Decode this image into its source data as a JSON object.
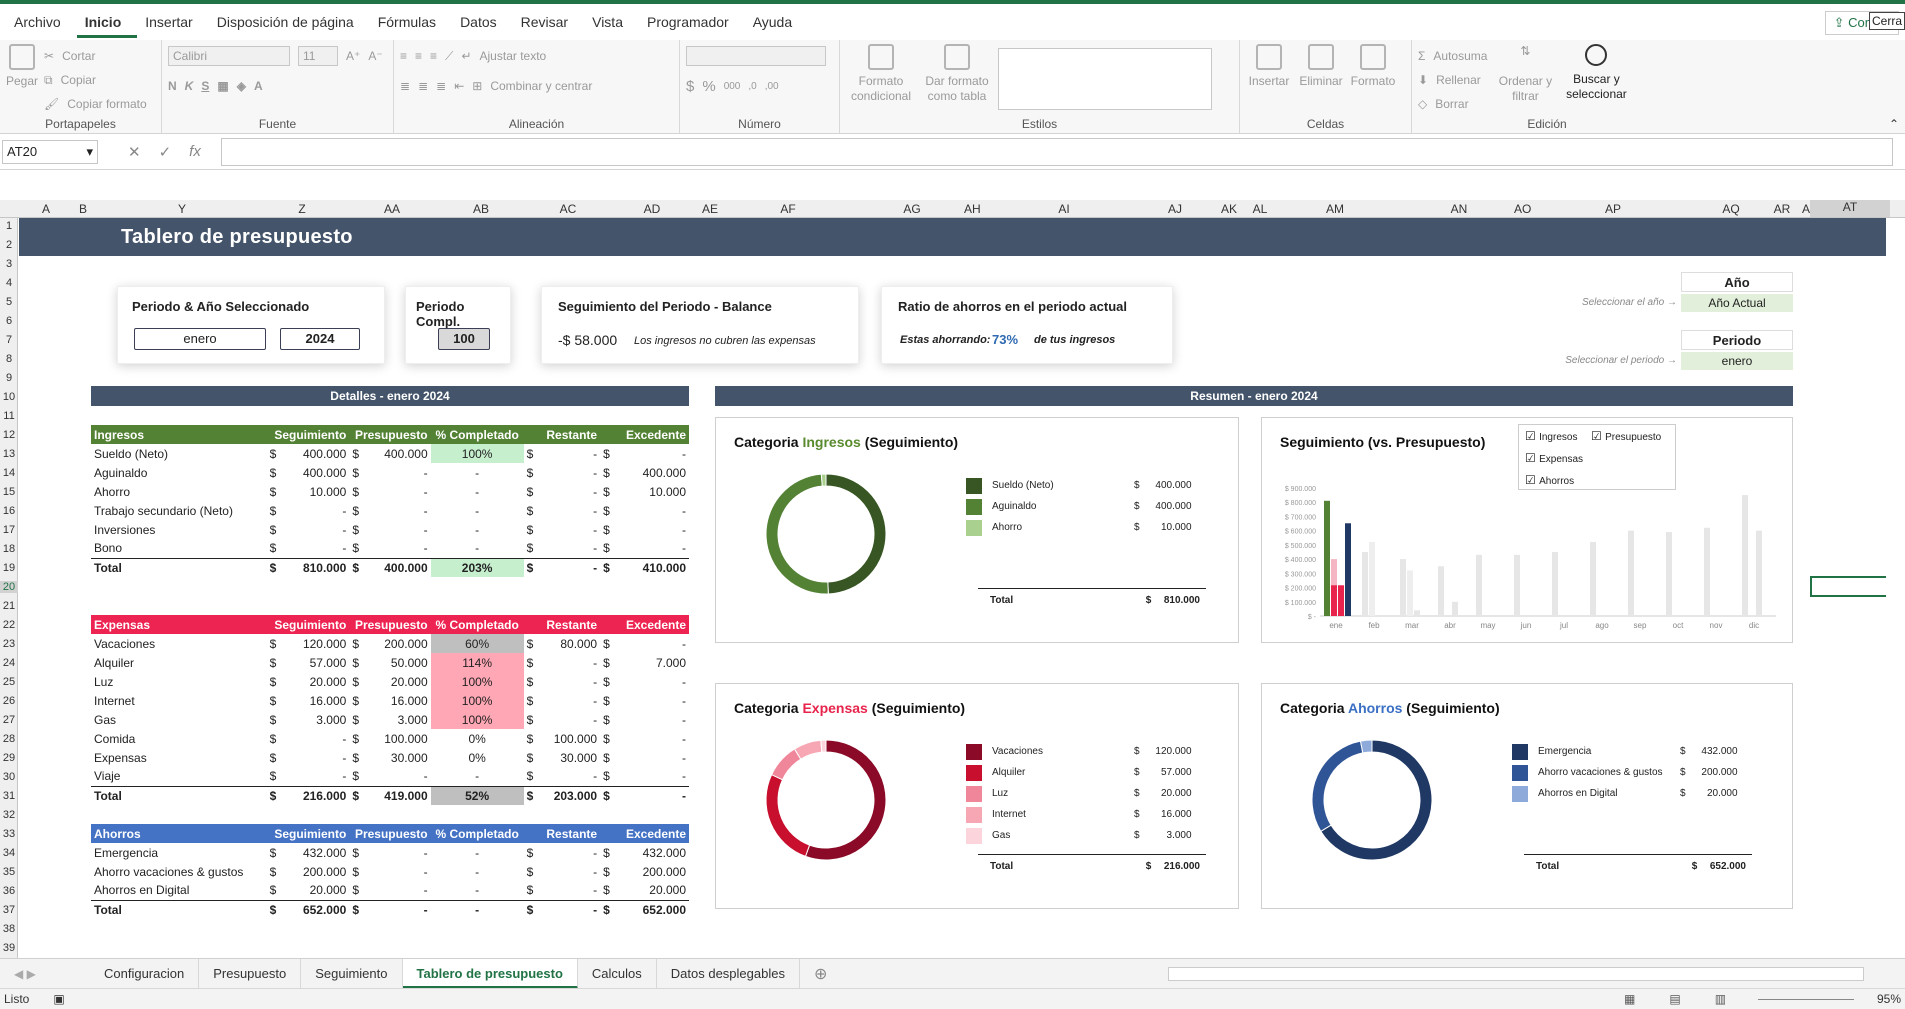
{
  "menu": [
    "Archivo",
    "Inicio",
    "Insertar",
    "Disposición de página",
    "Fórmulas",
    "Datos",
    "Revisar",
    "Vista",
    "Programador",
    "Ayuda"
  ],
  "share_label": "Compa",
  "tooltip": "Cerra",
  "ribbon": {
    "clipboard": {
      "paste": "Pegar",
      "cut": "Cortar",
      "copy": "Copiar",
      "format_painter": "Copiar formato",
      "label": "Portapapeles"
    },
    "font": {
      "name": "Calibri",
      "size": "11",
      "label": "Fuente"
    },
    "alignment": {
      "wrap": "Ajustar texto",
      "merge": "Combinar y centrar",
      "label": "Alineación"
    },
    "number": {
      "label": "Número"
    },
    "styles": {
      "cond": "Formato condicional",
      "table": "Dar formato como tabla",
      "label": "Estilos"
    },
    "cells": {
      "insert": "Insertar",
      "delete": "Eliminar",
      "format": "Formato",
      "label": "Celdas"
    },
    "editing": {
      "autosum": "Autosuma",
      "fill": "Rellenar",
      "clear": "Borrar",
      "sort": "Ordenar y filtrar",
      "find": "Buscar y seleccionar",
      "label": "Edición"
    }
  },
  "namebox": "AT20",
  "columns": [
    "A",
    "B",
    "Y",
    "Z",
    "AA",
    "AB",
    "AC",
    "AD",
    "AE",
    "AF",
    "AG",
    "AH",
    "AI",
    "AJ",
    "AK",
    "AL",
    "AM",
    "AN",
    "AO",
    "AP",
    "AQ",
    "AR",
    "AS",
    "AT"
  ],
  "rows": [
    "1",
    "2",
    "3",
    "4",
    "5",
    "6",
    "7",
    "8",
    "9",
    "10",
    "11",
    "12",
    "13",
    "14",
    "15",
    "16",
    "17",
    "18",
    "19",
    "20",
    "21",
    "22",
    "23",
    "24",
    "25",
    "26",
    "27",
    "28",
    "29",
    "30",
    "31",
    "32",
    "33",
    "34",
    "35",
    "36",
    "37",
    "38",
    "39"
  ],
  "dashboard": {
    "title": "Tablero de presupuesto",
    "period_card": {
      "title": "Periodo & Año Seleccionado",
      "month": "enero",
      "year": "2024"
    },
    "compl_card": {
      "title": "Periodo Compl.",
      "value": "100"
    },
    "balance_card": {
      "title": "Seguimiento del Periodo - Balance",
      "value": "-$ 58.000",
      "note": "Los ingresos no cubren las expensas"
    },
    "ratio_card": {
      "title": "Ratio de ahorros en el periodo actual",
      "pre": "Estas ahorrando:",
      "value": "73%",
      "post": "de tus ingresos"
    },
    "year_sel": {
      "header": "Año",
      "hint": "Seleccionar el año →",
      "value": "Año Actual"
    },
    "period_sel": {
      "header": "Periodo",
      "hint": "Seleccionar el periodo →",
      "value": "enero"
    },
    "details_title": "Detalles - enero 2024",
    "summary_title": "Resumen - enero 2024",
    "headers": [
      "Seguimiento",
      "Presupuesto",
      "% Completado",
      "Restante",
      "Excedente"
    ],
    "ingresos": {
      "name": "Ingresos",
      "rows": [
        {
          "cat": "Sueldo (Neto)",
          "seg": "400.000",
          "pre": "400.000",
          "pct": "100%",
          "rest": "-",
          "exc": "-"
        },
        {
          "cat": "Aguinaldo",
          "seg": "400.000",
          "pre": "-",
          "pct": "-",
          "rest": "-",
          "exc": "400.000"
        },
        {
          "cat": "Ahorro",
          "seg": "10.000",
          "pre": "-",
          "pct": "-",
          "rest": "-",
          "exc": "10.000"
        },
        {
          "cat": "Trabajo secundario (Neto)",
          "seg": "-",
          "pre": "-",
          "pct": "-",
          "rest": "-",
          "exc": "-"
        },
        {
          "cat": "Inversiones",
          "seg": "-",
          "pre": "-",
          "pct": "-",
          "rest": "-",
          "exc": "-"
        },
        {
          "cat": "Bono",
          "seg": "-",
          "pre": "-",
          "pct": "-",
          "rest": "-",
          "exc": "-"
        }
      ],
      "total": {
        "cat": "Total",
        "seg": "810.000",
        "pre": "400.000",
        "pct": "203%",
        "rest": "-",
        "exc": "410.000"
      }
    },
    "expensas": {
      "name": "Expensas",
      "rows": [
        {
          "cat": "Vacaciones",
          "seg": "120.000",
          "pre": "200.000",
          "pct": "60%",
          "rest": "80.000",
          "exc": "-"
        },
        {
          "cat": "Alquiler",
          "seg": "57.000",
          "pre": "50.000",
          "pct": "114%",
          "rest": "-",
          "exc": "7.000"
        },
        {
          "cat": "Luz",
          "seg": "20.000",
          "pre": "20.000",
          "pct": "100%",
          "rest": "-",
          "exc": "-"
        },
        {
          "cat": "Internet",
          "seg": "16.000",
          "pre": "16.000",
          "pct": "100%",
          "rest": "-",
          "exc": "-"
        },
        {
          "cat": "Gas",
          "seg": "3.000",
          "pre": "3.000",
          "pct": "100%",
          "rest": "-",
          "exc": "-"
        },
        {
          "cat": "Comida",
          "seg": "-",
          "pre": "100.000",
          "pct": "0%",
          "rest": "100.000",
          "exc": "-"
        },
        {
          "cat": "Expensas",
          "seg": "-",
          "pre": "30.000",
          "pct": "0%",
          "rest": "30.000",
          "exc": "-"
        },
        {
          "cat": "Viaje",
          "seg": "-",
          "pre": "-",
          "pct": "-",
          "rest": "-",
          "exc": "-"
        }
      ],
      "total": {
        "cat": "Total",
        "seg": "216.000",
        "pre": "419.000",
        "pct": "52%",
        "rest": "203.000",
        "exc": "-"
      }
    },
    "ahorros": {
      "name": "Ahorros",
      "rows": [
        {
          "cat": "Emergencia",
          "seg": "432.000",
          "pre": "-",
          "pct": "-",
          "rest": "-",
          "exc": "432.000"
        },
        {
          "cat": "Ahorro vacaciones & gustos",
          "seg": "200.000",
          "pre": "-",
          "pct": "-",
          "rest": "-",
          "exc": "200.000"
        },
        {
          "cat": "Ahorros en Digital",
          "seg": "20.000",
          "pre": "-",
          "pct": "-",
          "rest": "-",
          "exc": "20.000"
        }
      ],
      "total": {
        "cat": "Total",
        "seg": "652.000",
        "pre": "-",
        "pct": "-",
        "rest": "-",
        "exc": "652.000"
      }
    }
  },
  "chart_data": [
    {
      "type": "pie",
      "title_pre": "Categoria ",
      "title_hl": "Ingresos",
      "title_post": " (Seguimiento)",
      "hl_color": "#5a8a2e",
      "labels": [
        "Sueldo (Neto)",
        "Aguinaldo",
        "Ahorro"
      ],
      "values": [
        400000,
        400000,
        10000
      ],
      "display": [
        "400.000",
        "400.000",
        "10.000"
      ],
      "colors": [
        "#375623",
        "#548235",
        "#a9d08e"
      ],
      "total": "810.000",
      "total_label": "Total"
    },
    {
      "type": "pie",
      "title_pre": "Categoria ",
      "title_hl": "Expensas",
      "title_post": " (Seguimiento)",
      "hl_color": "#e8244c",
      "labels": [
        "Vacaciones",
        "Alquiler",
        "Luz",
        "Internet",
        "Gas"
      ],
      "values": [
        120000,
        57000,
        20000,
        16000,
        3000
      ],
      "display": [
        "120.000",
        "57.000",
        "20.000",
        "16.000",
        "3.000"
      ],
      "colors": [
        "#8b0a27",
        "#c8102e",
        "#f0869a",
        "#f7a6b4",
        "#fcd5dc"
      ],
      "total": "216.000",
      "total_label": "Total"
    },
    {
      "type": "pie",
      "title_pre": "Categoria ",
      "title_hl": "Ahorros",
      "title_post": " (Seguimiento)",
      "hl_color": "#3a6fc4",
      "labels": [
        "Emergencia",
        "Ahorro vacaciones & gustos",
        "Ahorros en Digital"
      ],
      "values": [
        432000,
        200000,
        20000
      ],
      "display": [
        "432.000",
        "200.000",
        "20.000"
      ],
      "colors": [
        "#1f3864",
        "#2f5597",
        "#8eaadb"
      ],
      "total": "652.000",
      "total_label": "Total"
    },
    {
      "type": "bar",
      "title": "Seguimiento (vs. Presupuesto)",
      "categories": [
        "ene",
        "feb",
        "mar",
        "abr",
        "may",
        "jun",
        "jul",
        "ago",
        "sep",
        "oct",
        "nov",
        "dic"
      ],
      "yticks": [
        "$ 900.000",
        "$ 800.000",
        "$ 700.000",
        "$ 600.000",
        "$ 500.000",
        "$ 400.000",
        "$ 300.000",
        "$ 200.000",
        "$ 100.000",
        "$ -"
      ],
      "ylim": [
        0,
        900000
      ],
      "legend": [
        "Ingresos",
        "Presupuesto",
        "Expensas",
        "Ahorros"
      ],
      "series": [
        {
          "name": "Ingresos",
          "values": [
            810000,
            450000,
            400000,
            350000,
            430000,
            430000,
            450000,
            520000,
            600000,
            590000,
            620000,
            850000
          ],
          "color": "#548235",
          "muted": "#e6e6e6"
        },
        {
          "name": "Presupuesto",
          "values": [
            400000,
            520000,
            320000,
            0,
            0,
            0,
            0,
            0,
            0,
            0,
            0,
            0
          ],
          "color": "#f4b6c2",
          "muted": "#eeeeee"
        },
        {
          "name": "Expensas",
          "values": [
            216000,
            0,
            40000,
            100000,
            0,
            0,
            0,
            0,
            0,
            0,
            0,
            600000
          ],
          "color": "#e8244c",
          "muted": "#e6e6e6"
        },
        {
          "name": "Ahorros",
          "values": [
            652000,
            0,
            0,
            0,
            0,
            0,
            0,
            0,
            0,
            0,
            0,
            0
          ],
          "color": "#203864",
          "muted": "#e6e6e6"
        }
      ]
    }
  ],
  "tabs": [
    "Configuracion",
    "Presupuesto",
    "Seguimiento",
    "Tablero de presupuesto",
    "Calculos",
    "Datos desplegables"
  ],
  "active_tab": "Tablero de presupuesto",
  "status": {
    "ready": "Listo",
    "zoom": "95%"
  }
}
